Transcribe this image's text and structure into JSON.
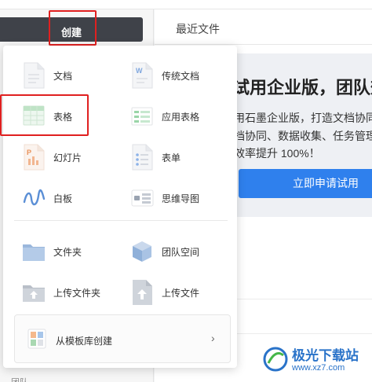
{
  "header": {
    "create_label": "创建",
    "recent_label": "最近文件"
  },
  "promo": {
    "title": "试用企业版，团队效",
    "line1": "用石墨企业版，打造文档协同",
    "line2": "档协同、数据收集、任务管理",
    "line3": "效率提升 100%！",
    "button": "立即申请试用"
  },
  "menu": {
    "items": [
      {
        "label": "文档",
        "icon": "doc-icon"
      },
      {
        "label": "传统文档",
        "icon": "word-doc-icon"
      },
      {
        "label": "表格",
        "icon": "sheet-icon"
      },
      {
        "label": "应用表格",
        "icon": "app-sheet-icon"
      },
      {
        "label": "幻灯片",
        "icon": "slides-icon"
      },
      {
        "label": "表单",
        "icon": "form-icon"
      },
      {
        "label": "白板",
        "icon": "whiteboard-icon"
      },
      {
        "label": "思维导图",
        "icon": "mindmap-icon"
      },
      {
        "label": "文件夹",
        "icon": "folder-icon"
      },
      {
        "label": "团队空间",
        "icon": "team-space-icon"
      },
      {
        "label": "上传文件夹",
        "icon": "upload-folder-icon"
      },
      {
        "label": "上传文件",
        "icon": "upload-file-icon"
      }
    ],
    "template_label": "从模板库创建",
    "template_arrow": "›"
  },
  "bottom": {
    "text": "团队"
  },
  "watermark": {
    "title": "极光下载站",
    "url": "www.xz7.com"
  },
  "colors": {
    "accent": "#2f80ed",
    "highlight": "#e02020",
    "dark_bar": "#3f4249"
  }
}
